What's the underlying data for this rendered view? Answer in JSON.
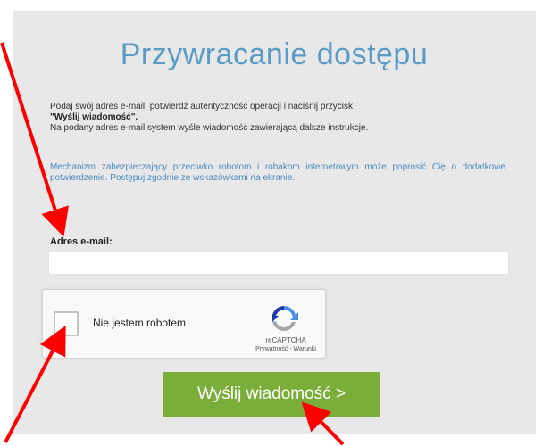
{
  "page": {
    "title": "Przywracanie dostępu",
    "instructions_line1": "Podaj swój adres e-mail, potwierdź autentyczność operacji i naciśnij przycisk",
    "instructions_bold": "\"Wyślij wiadomość\".",
    "instructions_line2": "Na podany adres e-mail system wyśle wiadomość zawierającą dalsze instrukcje.",
    "captcha_note": "Mechanizm zabezpieczający przeciwko robotom i robakom internetowym może poprosić Cię o dodatkowe potwierdzenie. Postępuj zgodnie ze wskazówkami na ekranie."
  },
  "form": {
    "email_label": "Adres e-mail:",
    "email_value": "",
    "email_placeholder": ""
  },
  "recaptcha": {
    "checkbox_label": "Nie jestem robotem",
    "brand": "reCAPTCHA",
    "links": "Prywatność - Warunki"
  },
  "submit": {
    "label": "Wyślij wiadomość >"
  },
  "colors": {
    "title": "#5b9bc8",
    "note": "#4a8ac4",
    "button": "#7aad3a",
    "panel": "#e8e8e8",
    "arrow": "#ff0000"
  }
}
